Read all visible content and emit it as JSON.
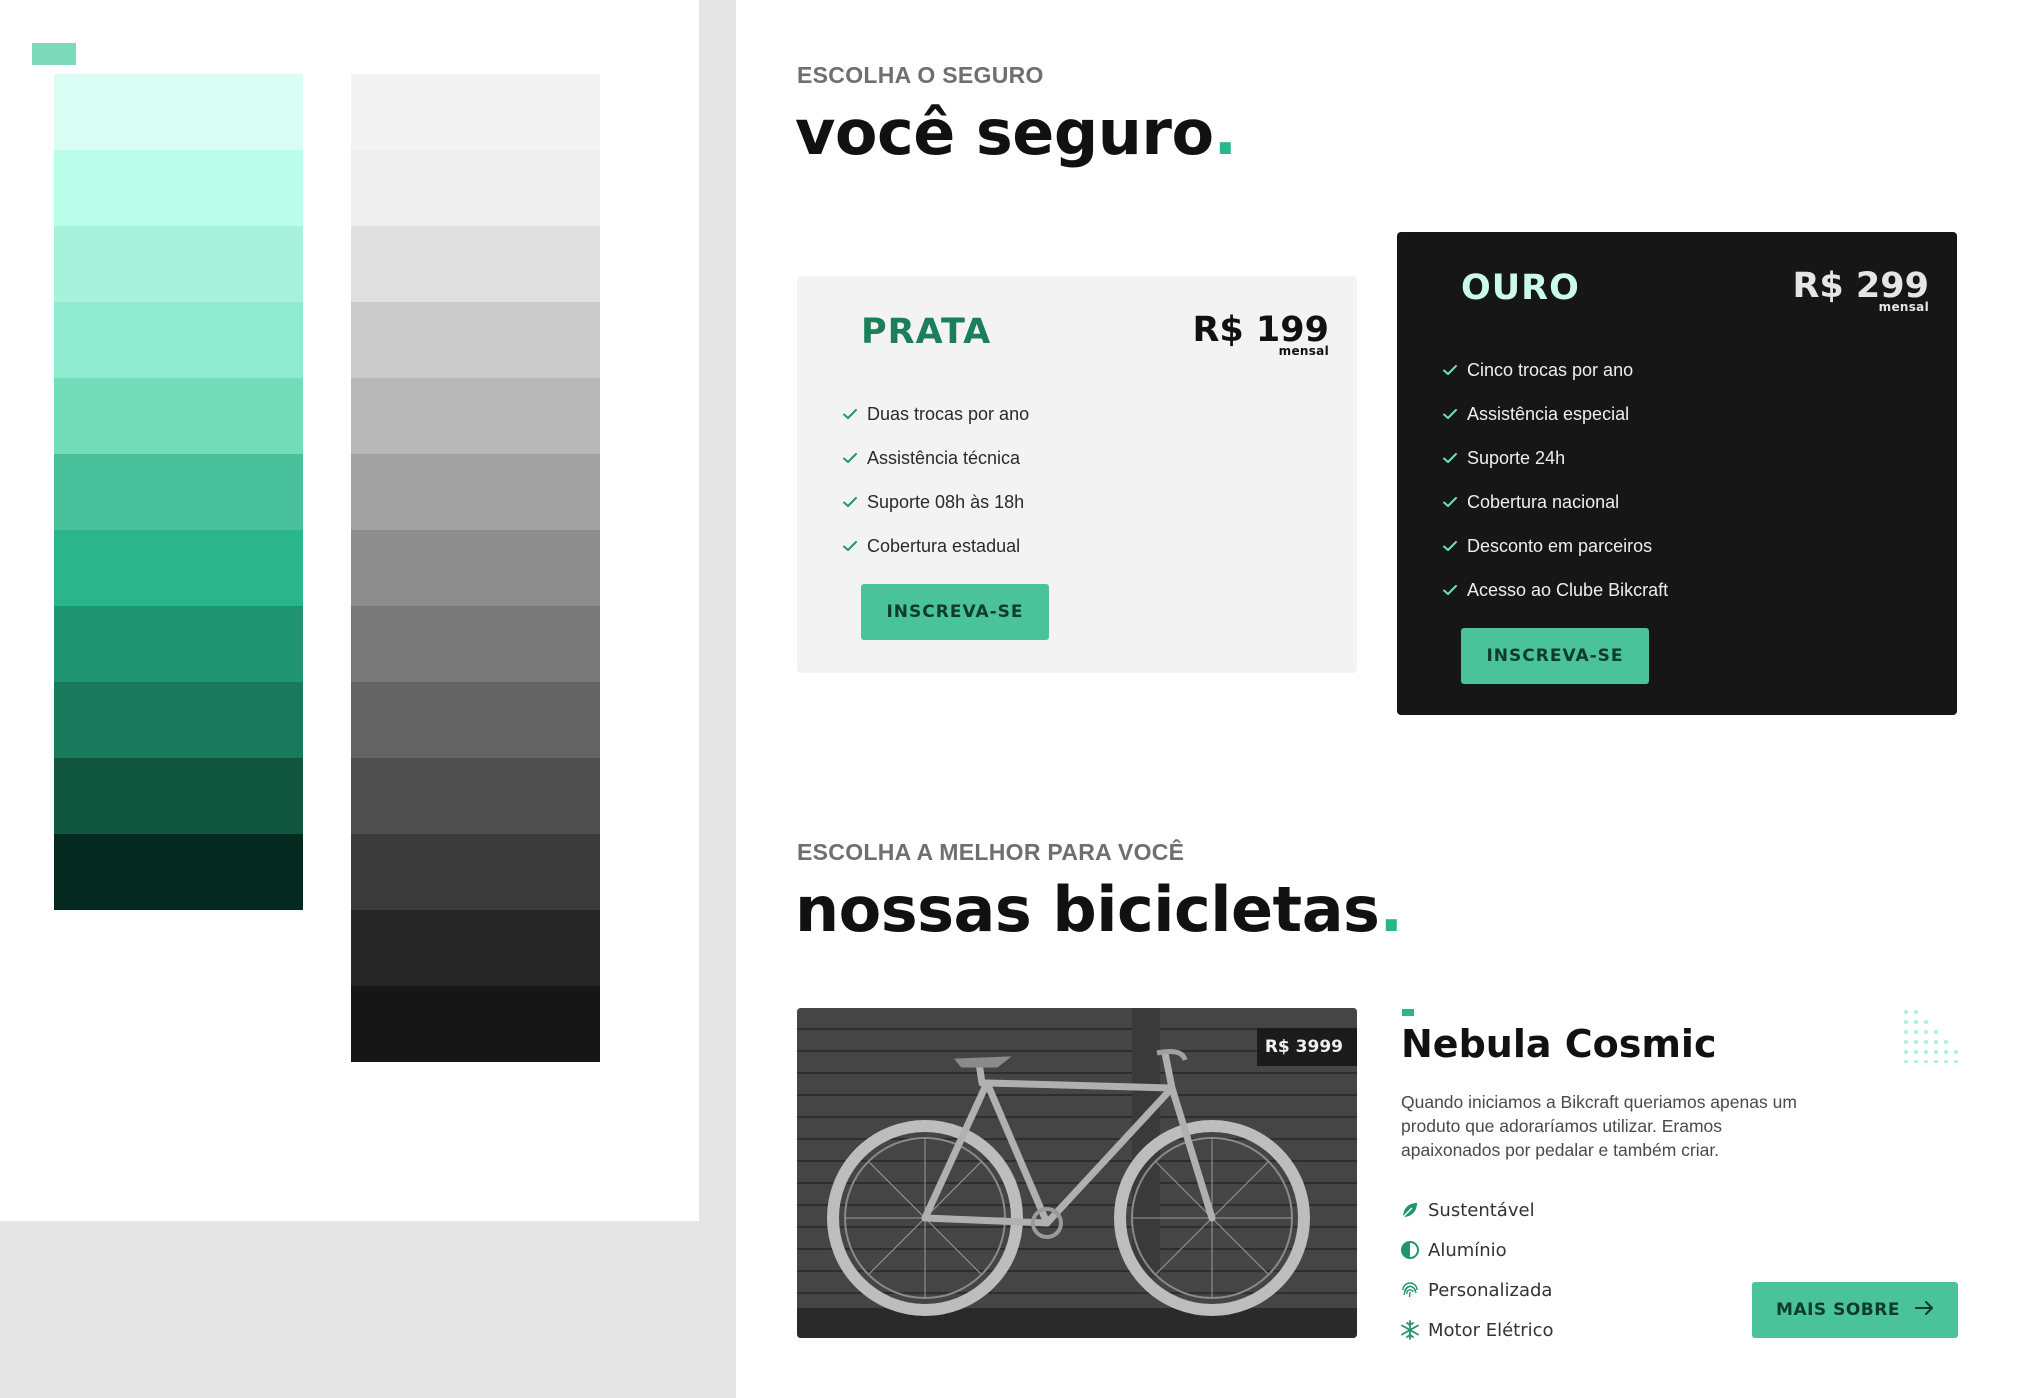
{
  "colors": {
    "accent": "#2bb58b",
    "button": "#4ac29a",
    "button_text": "#0e3b2c",
    "palette_tag": "#7ddbbb",
    "green_swatches": [
      "#d9fef3",
      "#bbfee9",
      "#a6f2da",
      "#8eebcf",
      "#73ddba",
      "#49c29b",
      "#2bb58b",
      "#1f9571",
      "#197a5b",
      "#115740",
      "#042a20"
    ],
    "gray_swatches": [
      "#f3f3f3",
      "#efefef",
      "#e0e0e0",
      "#cbcbcb",
      "#b8b8b8",
      "#a2a2a2",
      "#8d8d8d",
      "#787878",
      "#646464",
      "#4f4f4f",
      "#3b3b3b",
      "#262626",
      "#161616"
    ]
  },
  "insurance": {
    "eyebrow": "ESCOLHA O SEGURO",
    "title": "você seguro",
    "dot": ".",
    "plans": [
      {
        "name": "PRATA",
        "price": "R$ 199",
        "period": "mensal",
        "features": [
          "Duas trocas por ano",
          "Assistência técnica",
          "Suporte 08h às 18h",
          "Cobertura estadual"
        ],
        "button": "INSCREVA-SE"
      },
      {
        "name": "OURO",
        "price": "R$ 299",
        "period": "mensal",
        "features": [
          "Cinco trocas por ano",
          "Assistência especial",
          "Suporte 24h",
          "Cobertura nacional",
          "Desconto em parceiros",
          "Acesso ao Clube Bikcraft"
        ],
        "button": "INSCREVA-SE"
      }
    ]
  },
  "bikes": {
    "eyebrow": "ESCOLHA A MELHOR PARA VOCÊ",
    "title": "nossas bicicletas",
    "dot": ".",
    "item": {
      "price_badge": "R$ 3999",
      "name": "Nebula Cosmic",
      "description": "Quando iniciamos a Bikcraft queriamos apenas um produto que adoraríamos utilizar. Eramos apaixonados por pedalar e também criar.",
      "attributes": [
        {
          "icon": "leaf-icon",
          "label": "Sustentável"
        },
        {
          "icon": "half-circle-icon",
          "label": "Alumínio"
        },
        {
          "icon": "fingerprint-icon",
          "label": "Personalizada"
        },
        {
          "icon": "snowflake-icon",
          "label": "Motor Elétrico"
        }
      ],
      "more_button": "MAIS SOBRE",
      "more_icon": "arrow-right-icon"
    }
  }
}
